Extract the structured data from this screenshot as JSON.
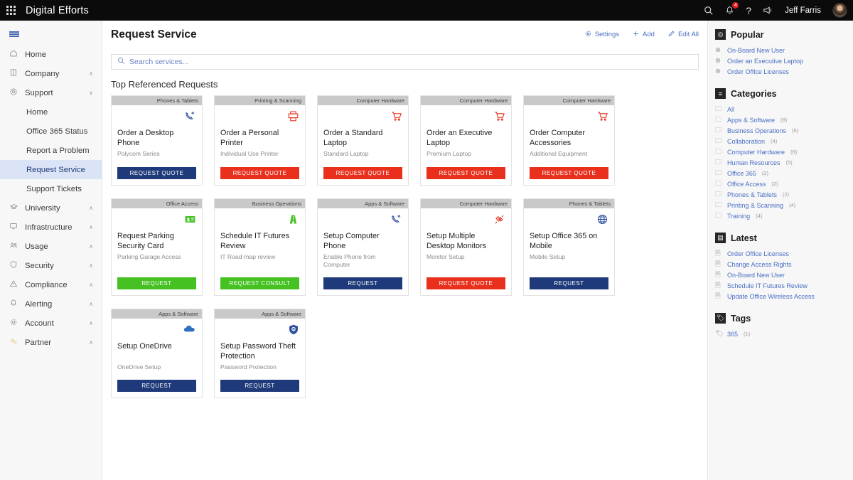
{
  "topbar": {
    "waffle_label": "app-launcher",
    "brand": "Digital Efforts",
    "search_icon": "search-icon",
    "bell_icon": "bell-icon",
    "bell_badge": "4",
    "help_icon": "help-icon",
    "megaphone_icon": "megaphone-icon",
    "username": "Jeff Farris"
  },
  "sidebar": {
    "items": [
      {
        "label": "Home",
        "icon": "home-icon",
        "chev": ""
      },
      {
        "label": "Company",
        "icon": "building-icon",
        "chev": "∧"
      },
      {
        "label": "Support",
        "icon": "support-icon",
        "chev": "∨"
      }
    ],
    "support_children": [
      {
        "label": "Home",
        "active": false
      },
      {
        "label": "Office 365 Status",
        "active": false
      },
      {
        "label": "Report a Problem",
        "active": false
      },
      {
        "label": "Request Service",
        "active": true
      },
      {
        "label": "Support Tickets",
        "active": false
      }
    ],
    "items_after": [
      {
        "label": "University",
        "icon": "graduation-icon",
        "chev": "∧"
      },
      {
        "label": "Infrastructure",
        "icon": "monitor-icon",
        "chev": "∧"
      },
      {
        "label": "Usage",
        "icon": "people-icon",
        "chev": "∧"
      },
      {
        "label": "Security",
        "icon": "shield-icon",
        "chev": "∧"
      },
      {
        "label": "Compliance",
        "icon": "warning-icon",
        "chev": "∧"
      },
      {
        "label": "Alerting",
        "icon": "bell-icon",
        "chev": "∧"
      },
      {
        "label": "Account",
        "icon": "gear-icon",
        "chev": "∧"
      },
      {
        "label": "Partner",
        "icon": "partner-gears-icon",
        "chev": "∧"
      }
    ]
  },
  "header": {
    "title": "Request Service",
    "settings_label": "Settings",
    "add_label": "Add",
    "edit_all_label": "Edit All"
  },
  "search": {
    "placeholder": "Search services...",
    "value": ""
  },
  "main": {
    "section_title": "Top Referenced Requests",
    "cards": [
      {
        "category": "Phones & Tablets",
        "icon": "phone-add-icon",
        "icon_color": "#2f4f9e",
        "title": "Order a Desktop Phone",
        "subtitle": "Polycom Series",
        "button": "REQUEST QUOTE",
        "button_color": "#1f3a7a"
      },
      {
        "category": "Printing & Scanning",
        "icon": "printer-icon",
        "icon_color": "#e8301c",
        "title": "Order a Personal Printer",
        "subtitle": "Individual Use Printer",
        "button": "REQUEST QUOTE",
        "button_color": "#e8301c"
      },
      {
        "category": "Computer Hardware",
        "icon": "cart-icon",
        "icon_color": "#e8301c",
        "title": "Order a Standard Laptop",
        "subtitle": "Standard Laptop",
        "button": "REQUEST QUOTE",
        "button_color": "#e8301c"
      },
      {
        "category": "Computer Hardware",
        "icon": "cart-icon",
        "icon_color": "#e8301c",
        "title": "Order an Executive Laptop",
        "subtitle": "Premium Laptop",
        "button": "REQUEST QUOTE",
        "button_color": "#e8301c"
      },
      {
        "category": "Computer Hardware",
        "icon": "cart-icon",
        "icon_color": "#e8301c",
        "title": "Order Computer Accessories",
        "subtitle": "Additional Equipment",
        "button": "REQUEST QUOTE",
        "button_color": "#e8301c"
      },
      {
        "category": "Office Access",
        "icon": "id-badge-icon",
        "icon_color": "#45c122",
        "title": "Request Parking Security Card",
        "subtitle": "Parking Garage Access",
        "button": "REQUEST",
        "button_color": "#45c122"
      },
      {
        "category": "Business Operations",
        "icon": "road-icon",
        "icon_color": "#45c122",
        "title": "Schedule IT Futures Review",
        "subtitle": "IT Road-map review",
        "button": "REQUEST CONSULT",
        "button_color": "#45c122"
      },
      {
        "category": "Apps & Software",
        "icon": "phone-add-icon",
        "icon_color": "#2f4f9e",
        "title": "Setup Computer Phone",
        "subtitle": "Enable Phone from Computer",
        "button": "REQUEST",
        "button_color": "#1f3a7a"
      },
      {
        "category": "Computer Hardware",
        "icon": "connector-icon",
        "icon_color": "#e8301c",
        "title": "Setup Multiple Desktop Monitors",
        "subtitle": "Monitor Setup",
        "button": "REQUEST QUOTE",
        "button_color": "#e8301c"
      },
      {
        "category": "Phones & Tablets",
        "icon": "globe-icon",
        "icon_color": "#2f4f9e",
        "title": "Setup Office 365 on Mobile",
        "subtitle": "Mobile Setup",
        "button": "REQUEST",
        "button_color": "#1f3a7a"
      },
      {
        "category": "Apps & Software",
        "icon": "cloud-icon",
        "icon_color": "#2f6fbf",
        "title": "Setup OneDrive",
        "subtitle": "OneDrive Setup",
        "button": "REQUEST",
        "button_color": "#1f3a7a"
      },
      {
        "category": "Apps & Software",
        "icon": "shield-lock-icon",
        "icon_color": "#2f4f9e",
        "title": "Setup Password Theft Protection",
        "subtitle": "Password Protection",
        "button": "REQUEST",
        "button_color": "#1f3a7a"
      }
    ]
  },
  "rightpanel": {
    "popular": {
      "title": "Popular",
      "icon": "target-icon",
      "items": [
        {
          "label": "On-Board New User",
          "icon": "globe-icon"
        },
        {
          "label": "Order an Executive Laptop",
          "icon": "globe-icon"
        },
        {
          "label": "Order Office Licenses",
          "icon": "globe-icon"
        }
      ]
    },
    "categories": {
      "title": "Categories",
      "icon": "list-icon",
      "items": [
        {
          "label": "All",
          "count": ""
        },
        {
          "label": "Apps & Software",
          "count": "(8)"
        },
        {
          "label": "Business Operations",
          "count": "(6)"
        },
        {
          "label": "Collaboration",
          "count": "(4)"
        },
        {
          "label": "Computer Hardware",
          "count": "(6)"
        },
        {
          "label": "Human Resources",
          "count": "(5)"
        },
        {
          "label": "Office 365",
          "count": "(2)"
        },
        {
          "label": "Office Access",
          "count": "(2)"
        },
        {
          "label": "Phones & Tablets",
          "count": "(2)"
        },
        {
          "label": "Printing & Scanning",
          "count": "(4)"
        },
        {
          "label": "Training",
          "count": "(4)"
        }
      ]
    },
    "latest": {
      "title": "Latest",
      "icon": "news-icon",
      "items": [
        {
          "label": "Order Office Licenses"
        },
        {
          "label": "Change Access Rights"
        },
        {
          "label": "On-Board New User"
        },
        {
          "label": "Schedule IT Futures Review"
        },
        {
          "label": "Update Office Wireless Access"
        }
      ]
    },
    "tags": {
      "title": "Tags",
      "icon": "tag-icon",
      "items": [
        {
          "label": "365",
          "count": "(1)"
        }
      ]
    }
  }
}
